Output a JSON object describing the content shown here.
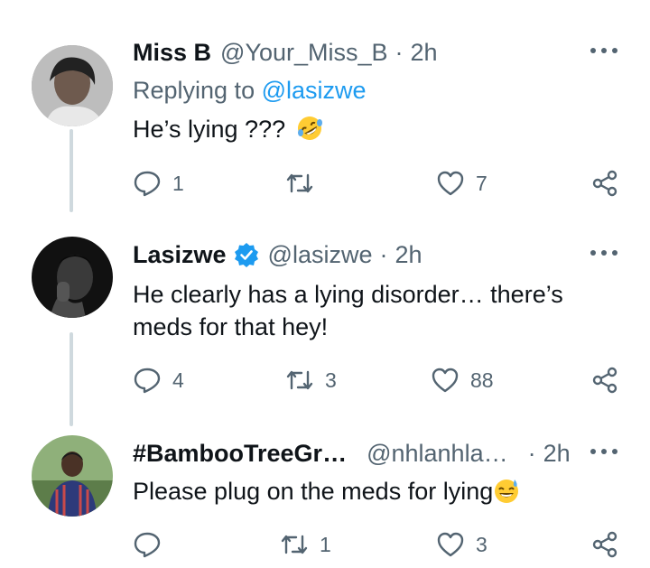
{
  "tweets": [
    {
      "name": "Miss B",
      "handle": "@Your_Miss_B",
      "time": "2h",
      "reply_prefix": "Replying to",
      "reply_to": "@lasizwe",
      "text": "He’s lying ???",
      "emoji": "rolling-on-floor-laughing",
      "replies": "1",
      "retweets": "",
      "likes": "7",
      "verified": false
    },
    {
      "name": "Lasizwe",
      "handle": "@lasizwe",
      "time": "2h",
      "text_line1": "He clearly has a lying disorder… there’s",
      "text_line2": "meds for that hey!",
      "replies": "4",
      "retweets": "3",
      "likes": "88",
      "verified": true
    },
    {
      "name": "#BambooTreeGr…",
      "handle": "@nhlanhla…",
      "time": "2h",
      "text": "Please plug on the meds for lying",
      "emoji": "grinning-sweat",
      "replies": "",
      "retweets": "1",
      "likes": "3",
      "verified": false
    }
  ],
  "separator": "·",
  "colors": {
    "accent": "#1d9bf0",
    "muted": "#536471",
    "text": "#0f1419",
    "thread": "#cfd9de"
  },
  "icons": [
    "reply-icon",
    "retweet-icon",
    "like-icon",
    "share-icon",
    "more-icon",
    "verified-icon"
  ]
}
